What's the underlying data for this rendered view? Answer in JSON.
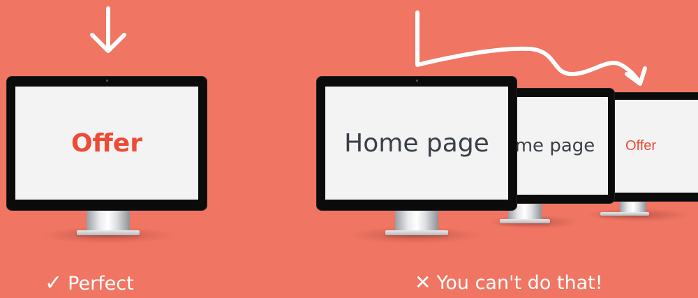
{
  "left_panel": {
    "screen_text": "Offer",
    "caption_mark": "✓",
    "caption_text": "Perfect"
  },
  "right_panel": {
    "screen1_text": "Home page",
    "screen2_text": "me page",
    "screen3_text": "Offer",
    "caption_mark": "✕",
    "caption_text": "You can't do that!"
  },
  "colors": {
    "background": "#f07563",
    "offer_text": "#ee4a36",
    "home_text": "#3a3f48",
    "screen": "#f3f3f3",
    "bezel": "#0b0b0b",
    "arrows": "#ffffff"
  },
  "icons": {
    "down_arrow": "arrow-down-icon",
    "curved_arrow": "curved-arrow-icon",
    "check": "check-icon",
    "cross": "cross-icon"
  }
}
